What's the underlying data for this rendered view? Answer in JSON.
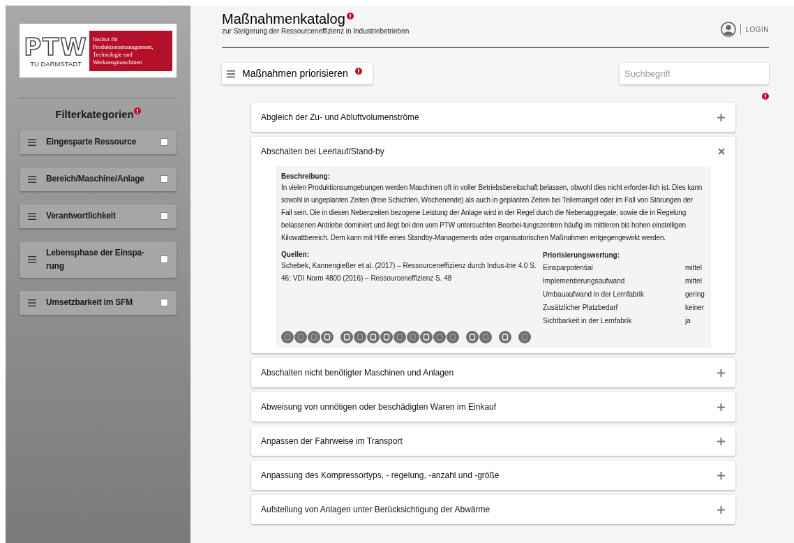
{
  "sidebar": {
    "logo": {
      "mark": "PTW",
      "university": "TU DARMSTADT",
      "institute_lines": [
        "Institut für",
        "Produktionsmanagement,",
        "Technologie und",
        "Werkzeugmaschinen"
      ]
    },
    "heading": "Filterkategorien",
    "filters": [
      {
        "label": "Eingesparte Ressource",
        "checked": false
      },
      {
        "label": "Bereich/Maschine/Anlage",
        "checked": false
      },
      {
        "label": "Verantwortlichkeit",
        "checked": false
      },
      {
        "label": "Lebensphase der Einspa-rung",
        "checked": false
      },
      {
        "label": "Umsetzbarkeit im SFM",
        "checked": false
      }
    ]
  },
  "header": {
    "title": "Maßnahmenkatalog",
    "subtitle": "zur Steigerung der Ressourceneffizienz in Industriebetrieben",
    "login": "LOGIN"
  },
  "toolbar": {
    "prioritize": "Maßnahmen priorisieren",
    "search": {
      "placeholder": "Suchbegriff"
    }
  },
  "measures": [
    {
      "title": "Abgleich der Zu- und Abluftvolumenströme",
      "expanded": false
    },
    {
      "title": "Abschalten bei Leerlauf/Stand-by",
      "expanded": true,
      "description_label": "Beschreibung:",
      "description": "In vielen Produktionsumgebungen werden Maschinen oft in voller Betriebsbereitschaft belassen, obwohl dies nicht erforder-lich ist. Dies kann sowohl in ungeplanten Zeiten (freie Schichten, Wochenende) als auch in geplanten Zeiten bei Teilemangel oder im Fall von Störungen der Fall sein. Die in diesen Nebenzeiten bezogene Leistung der Anlage wird in der Regel durch die Nebenaggregate, sowie die in Regelung belassenen Antriebe dominiert und liegt bei den vom PTW untersuchten Bearbei-tungszentren häufig im mittleren bis hohen einstelligen Kilowattbereich. Dem kann mit Hilfe eines Standby-Managements oder organisatorischen Maßnahmen entgegengewirkt werden.",
      "sources_label": "Quellen:",
      "sources": "Schebek, Kannengießer et al. (2017) – Ressourceneffizienz durch Indus-trie 4.0 S. 46; VDI Norm 4800 (2016) – Ressourceneffizienz S. 48",
      "rating_label": "Priorisierungswertung:",
      "ratings": [
        {
          "name": "Einsparpotential",
          "value": "mittel"
        },
        {
          "name": "Implementierungsaufwand",
          "value": "mittel"
        },
        {
          "name": "Umbauaufwand in der Lernfabrik",
          "value": "gering"
        },
        {
          "name": "Zusätzlicher Platzbedarf",
          "value": "keiner"
        },
        {
          "name": "Sichtbarkeit in der Lernfabrik",
          "value": "ja"
        }
      ],
      "icon_groups": [
        [
          {
            "active": false
          },
          {
            "active": false
          },
          {
            "active": false
          },
          {
            "active": true
          }
        ],
        [
          {
            "active": true
          },
          {
            "active": false
          },
          {
            "active": true
          },
          {
            "active": true
          },
          {
            "active": false
          },
          {
            "active": false
          },
          {
            "active": true
          },
          {
            "active": false
          },
          {
            "active": false
          }
        ],
        [
          {
            "active": true
          },
          {
            "active": false
          }
        ],
        [
          {
            "active": true
          }
        ],
        [
          {
            "active": false
          }
        ]
      ]
    },
    {
      "title": "Abschalten nicht benötigter Maschinen und Anlagen",
      "expanded": false
    },
    {
      "title": "Abweisung von unnötigen oder beschädigten Waren im Einkauf",
      "expanded": false
    },
    {
      "title": "Anpassen der Fahrweise im Transport",
      "expanded": false
    },
    {
      "title": "Anpassung des Kompressortyps, - regelung, -anzahl und -größe",
      "expanded": false
    },
    {
      "title": "Aufstellung von Anlagen unter Berücksichtigung der Abwärme",
      "expanded": false
    }
  ]
}
